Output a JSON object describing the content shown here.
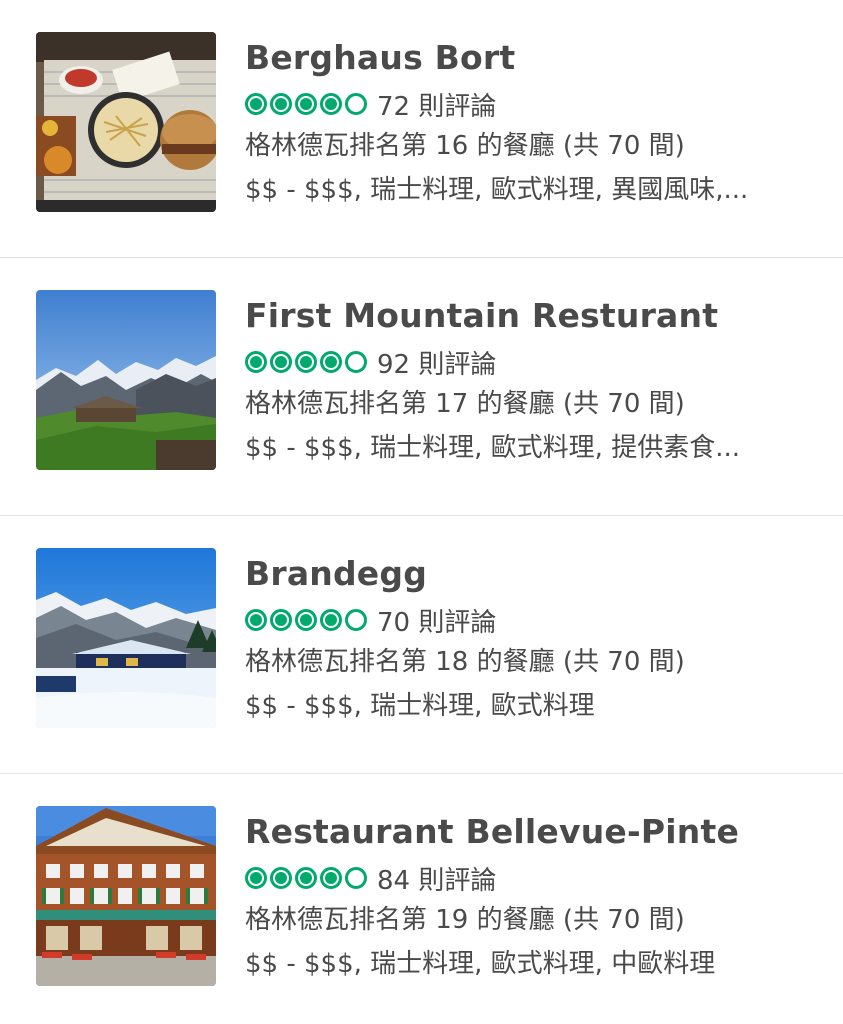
{
  "restaurants": [
    {
      "name": "Berghaus Bort",
      "rating": 4.5,
      "reviews": "72 則評論",
      "rank": "格林德瓦排名第 16 的餐廳 (共 70 間)",
      "cuisine": "$$ - $$$, 瑞士料理, 歐式料理, 異國風味,..."
    },
    {
      "name": "First Mountain Resturant",
      "rating": 4.5,
      "reviews": "92 則評論",
      "rank": "格林德瓦排名第 17 的餐廳 (共 70 間)",
      "cuisine": "$$ - $$$, 瑞士料理, 歐式料理, 提供素食..."
    },
    {
      "name": "Brandegg",
      "rating": 4.5,
      "reviews": "70 則評論",
      "rank": "格林德瓦排名第 18 的餐廳 (共 70 間)",
      "cuisine": "$$ - $$$, 瑞士料理, 歐式料理"
    },
    {
      "name": "Restaurant Bellevue-Pinte",
      "rating": 4.5,
      "reviews": "84 則評論",
      "rank": "格林德瓦排名第 19 的餐廳 (共 70 間)",
      "cuisine": "$$ - $$$, 瑞士料理, 歐式料理, 中歐料理"
    }
  ],
  "colors": {
    "rating_green": "#00aa6c",
    "text": "#4a4a4a",
    "divider": "#e4e4e4"
  }
}
